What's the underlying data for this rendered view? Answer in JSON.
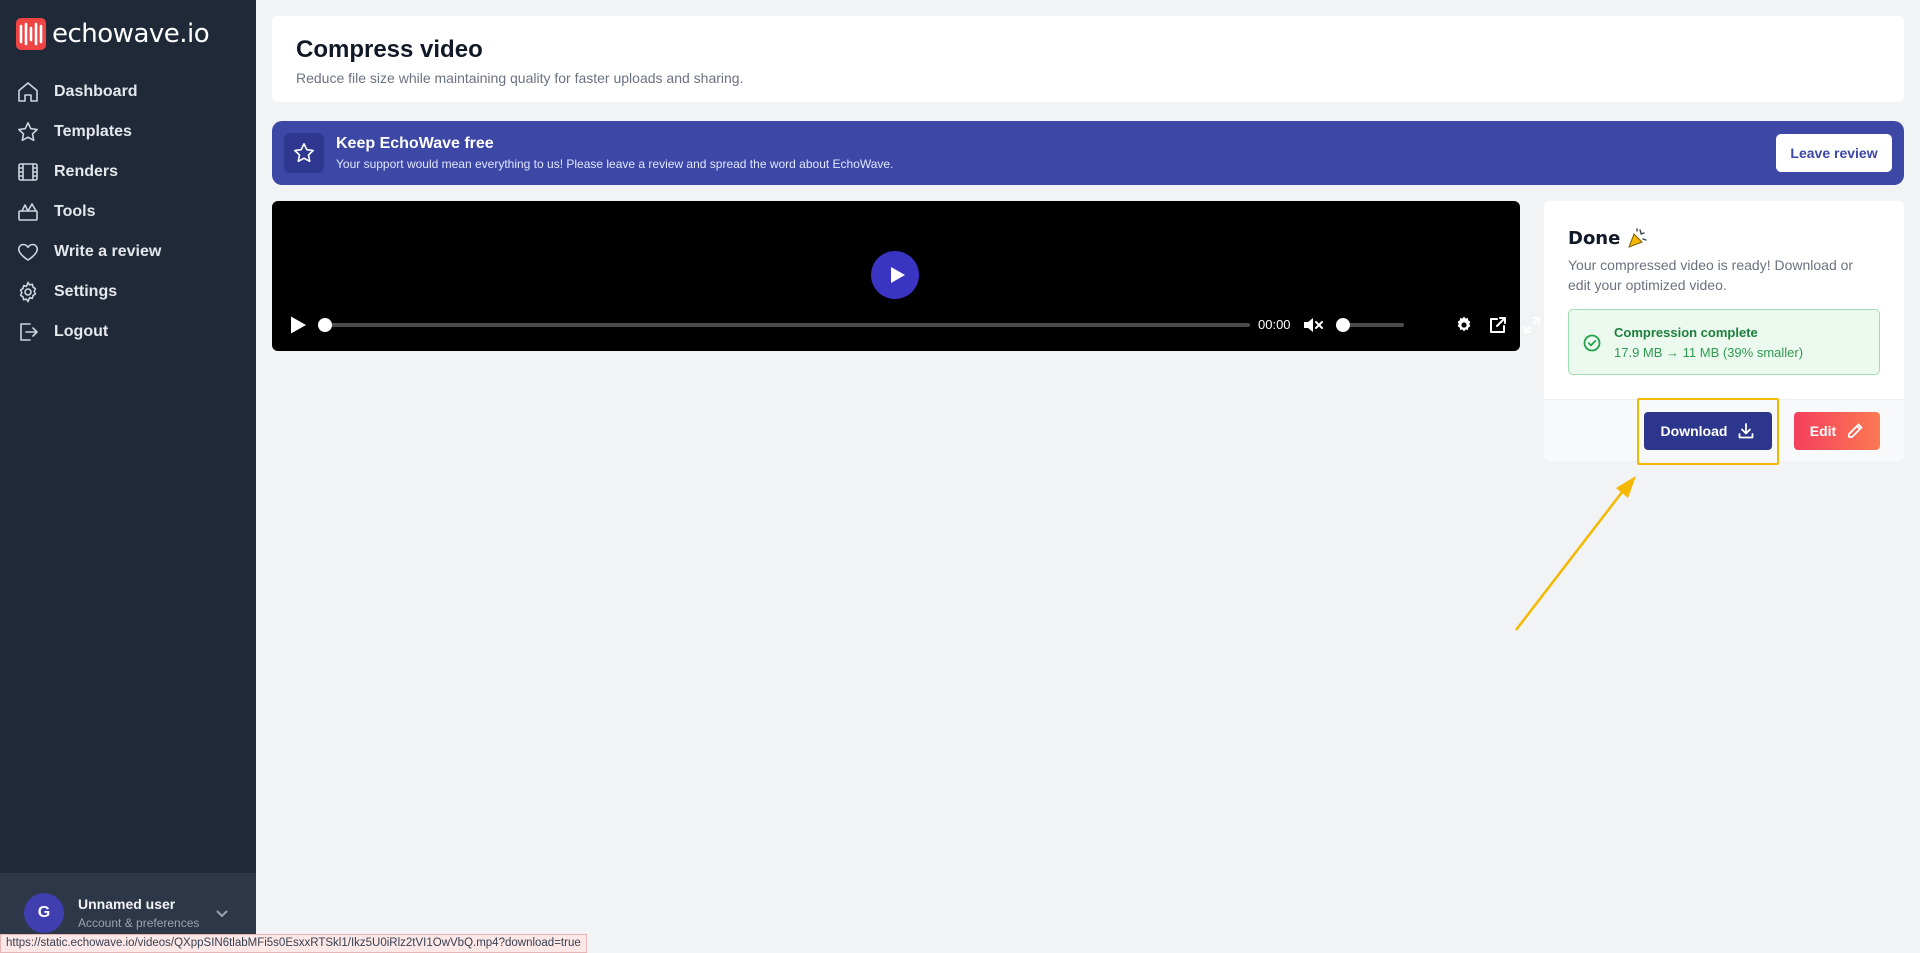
{
  "app": {
    "logo_text": "echowave.io"
  },
  "sidebar": {
    "items": [
      {
        "label": "Dashboard",
        "icon": "home-icon"
      },
      {
        "label": "Templates",
        "icon": "star-icon"
      },
      {
        "label": "Renders",
        "icon": "film-icon"
      },
      {
        "label": "Tools",
        "icon": "tools-icon"
      },
      {
        "label": "Write a review",
        "icon": "heart-icon"
      },
      {
        "label": "Settings",
        "icon": "gear-icon"
      },
      {
        "label": "Logout",
        "icon": "logout-icon"
      }
    ],
    "user": {
      "initial": "G",
      "name": "Unnamed user",
      "subtitle": "Account & preferences"
    }
  },
  "header": {
    "title": "Compress video",
    "subtitle": "Reduce file size while maintaining quality for faster uploads and sharing."
  },
  "banner": {
    "title": "Keep EchoWave free",
    "description": "Your support would mean everything to us! Please leave a review and spread the word about EchoWave.",
    "button_label": "Leave review"
  },
  "player": {
    "time": "00:00",
    "progress": 0,
    "volume": 0,
    "muted": true
  },
  "result": {
    "title": "Done",
    "description": "Your compressed video is ready! Download or edit your optimized video.",
    "status_title": "Compression complete",
    "status_detail": "17.9 MB → 11 MB (39% smaller)",
    "download_label": "Download",
    "edit_label": "Edit"
  },
  "statusbar": {
    "url": "https://static.echowave.io/videos/QXppSIN6tlabMFi5s0EsxxRTSkl1/Ikz5U0iRlz2tVI1OwVbQ.mp4?download=true"
  },
  "colors": {
    "sidebar_bg": "#1f2937",
    "banner_bg": "#3c47a6",
    "primary_button": "#2c368d",
    "edit_gradient_start": "#f43f5e",
    "edit_gradient_end": "#fb7a52",
    "success_bg": "#ecf9ef",
    "highlight": "#f5b800"
  }
}
